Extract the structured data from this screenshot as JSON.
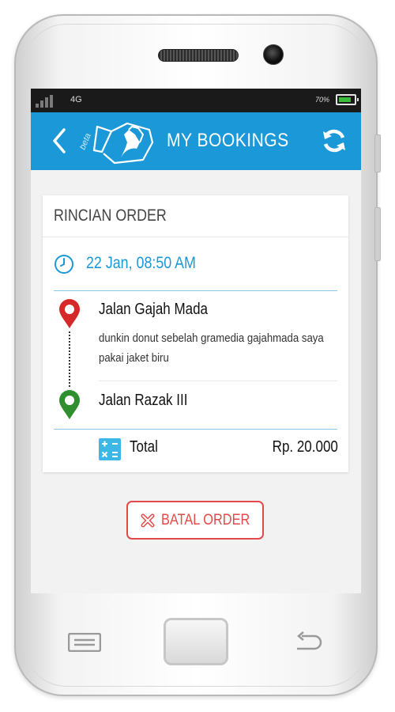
{
  "status_bar": {
    "network": "4G",
    "battery_percent": "70%",
    "battery_level": 0.7
  },
  "app_bar": {
    "logo_badge": "beta",
    "title": "MY BOOKINGS"
  },
  "order": {
    "section_title": "RINCIAN ORDER",
    "datetime": "22 Jan, 08:50 AM",
    "pickup": {
      "name": "Jalan Gajah Mada",
      "note": "dunkin donut sebelah gramedia gajahmada saya pakai jaket biru"
    },
    "dropoff": {
      "name": "Jalan Razak III"
    },
    "total_label": "Total",
    "total_value": "Rp. 20.000"
  },
  "cancel_button": {
    "label": "BATAL ORDER"
  },
  "colors": {
    "primary": "#1a98d8",
    "danger": "#e24a4a",
    "pickup_pin": "#d62828",
    "dropoff_pin": "#2f8f2f"
  },
  "icons": [
    "signal-icon",
    "battery-icon",
    "back-icon",
    "logo-icon",
    "refresh-icon",
    "clock-icon",
    "pickup-pin-icon",
    "dropoff-pin-icon",
    "calculator-icon",
    "cancel-icon",
    "menu-icon",
    "home-button",
    "back-nav-icon"
  ]
}
